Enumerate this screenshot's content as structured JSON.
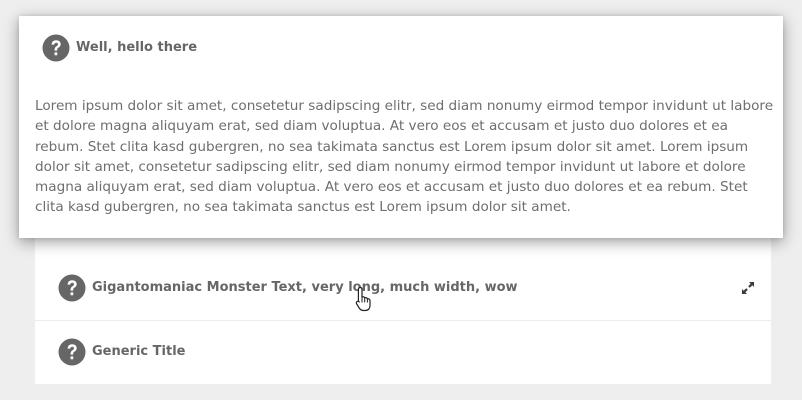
{
  "accordion": {
    "open_panel": {
      "title": "Well, hello there",
      "icon": "question-circle-icon",
      "body": "Lorem ipsum dolor sit amet, consetetur sadipscing elitr, sed diam nonumy eirmod tempor invidunt ut labore et dolore magna aliquyam erat, sed diam voluptua. At vero eos et accusam et justo duo dolores et ea rebum. Stet clita kasd gubergren, no sea takimata sanctus est Lorem ipsum dolor sit amet. Lorem ipsum dolor sit amet, consetetur sadipscing elitr, sed diam nonumy eirmod tempor invidunt ut labore et dolore magna aliquyam erat, sed diam voluptua. At vero eos et accusam et justo duo dolores et ea rebum. Stet clita kasd gubergren, no sea takimata sanctus est Lorem ipsum dolor sit amet."
    },
    "items": [
      {
        "title": "Gigantomaniac Monster Text, very long, much width, wow",
        "icon": "question-circle-icon",
        "action_icon": "expand-arrows-icon"
      },
      {
        "title": "Generic Title",
        "icon": "question-circle-icon"
      }
    ]
  },
  "colors": {
    "background": "#eeeeee",
    "panel": "#ffffff",
    "icon": "#666666",
    "text": "#6e6e6e"
  }
}
